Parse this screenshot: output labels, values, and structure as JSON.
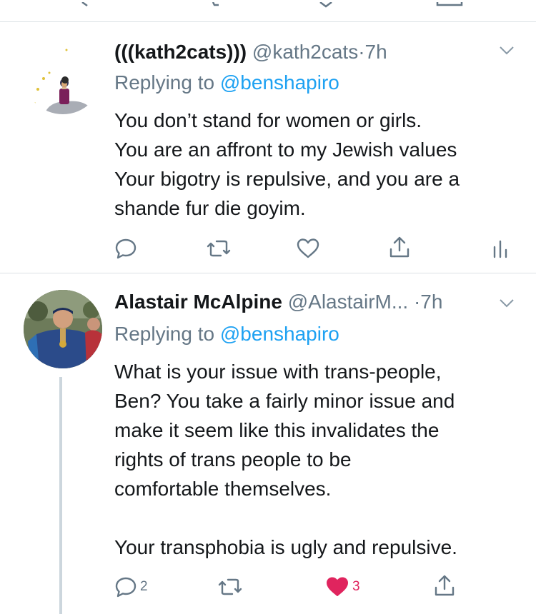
{
  "tweets": [
    {
      "display_name": "(((kath2cats)))",
      "handle": "@kath2cats",
      "separator": "·",
      "time": "7h",
      "replying_prefix": "Replying to",
      "replying_to": "@benshapiro",
      "text": "You don’t stand for women or girls.\nYou are an affront to my Jewish values\nYour bigotry is repulsive, and you are a\nshande fur die goyim.",
      "actions": {
        "reply_count": "",
        "retweet_count": "",
        "like_count": "",
        "share_count": ""
      }
    },
    {
      "display_name": "Alastair McAlpine",
      "handle": "@AlastairM...",
      "separator": "·",
      "time": "7h",
      "replying_prefix": "Replying to",
      "replying_to": "@benshapiro",
      "text": "What is your issue with trans-people,\nBen? You take a fairly minor issue and\nmake it seem like this invalidates the\nrights of trans people to be\ncomfortable themselves.\n\nYour transphobia is ugly and repulsive.",
      "actions": {
        "reply_count": "2",
        "retweet_count": "",
        "like_count": "3",
        "liked": true,
        "share_count": ""
      }
    }
  ],
  "colors": {
    "accent": "#1da1f2",
    "muted": "#657786",
    "like_red": "#e0245e",
    "divider": "#dbe1e5",
    "thread_line": "#ccd6dd"
  },
  "icons": [
    "reply-icon",
    "retweet-icon",
    "like-icon",
    "share-icon",
    "analytics-icon",
    "chevron-down-icon"
  ]
}
